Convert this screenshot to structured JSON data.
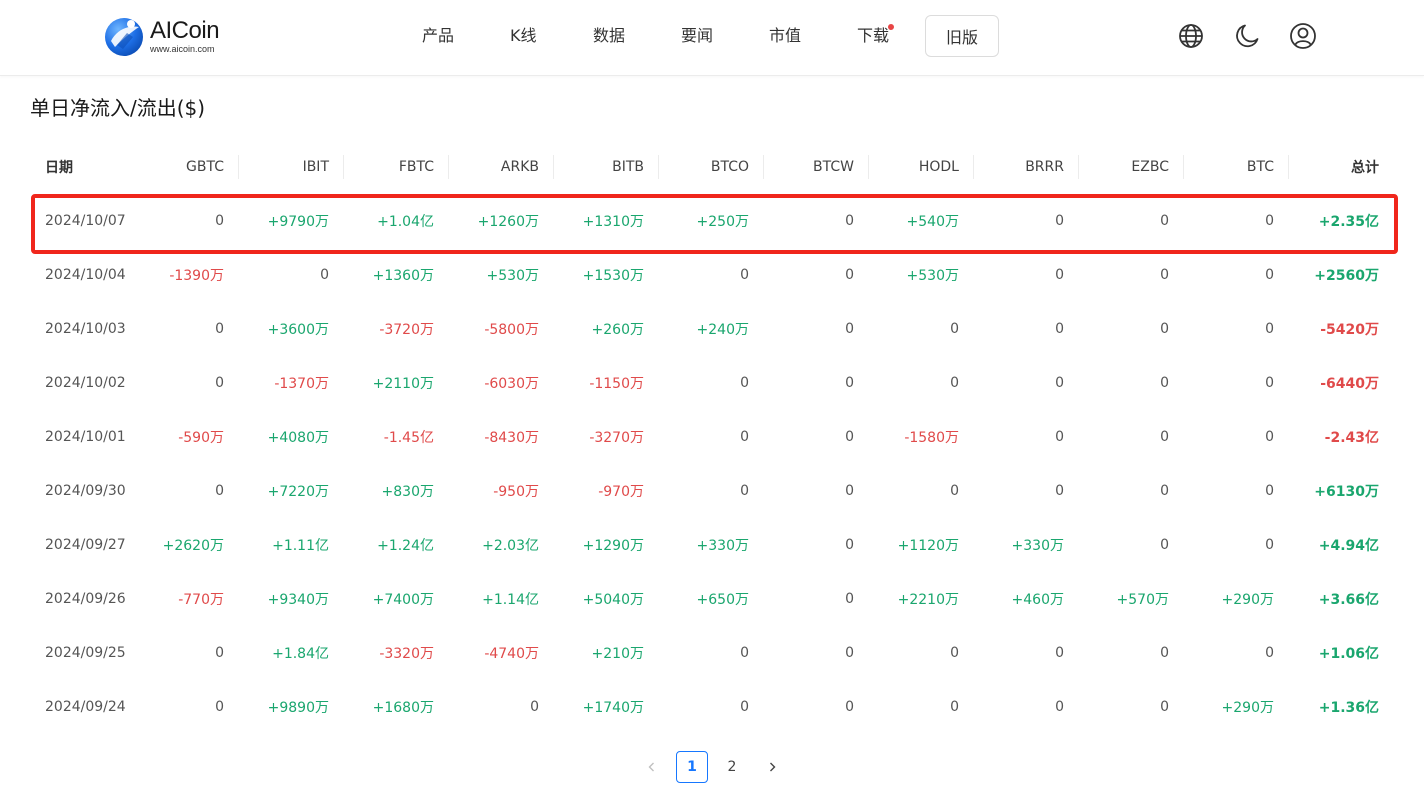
{
  "brand": {
    "name": "AICoin",
    "url": "www.aicoin.com"
  },
  "nav": {
    "items": [
      {
        "label": "产品"
      },
      {
        "label": "K线"
      },
      {
        "label": "数据"
      },
      {
        "label": "要闻"
      },
      {
        "label": "市值"
      },
      {
        "label": "下载",
        "has_dot": true
      }
    ],
    "old_version_label": "旧版"
  },
  "header_icons": [
    "globe-icon",
    "moon-icon",
    "user-icon"
  ],
  "section_title": "单日净流入/流出($)",
  "table": {
    "columns": [
      "日期",
      "GBTC",
      "IBIT",
      "FBTC",
      "ARKB",
      "BITB",
      "BTCO",
      "BTCW",
      "HODL",
      "BRRR",
      "EZBC",
      "BTC",
      "总计"
    ],
    "rows": [
      [
        "2024/10/07",
        "0",
        "+9790万",
        "+1.04亿",
        "+1260万",
        "+1310万",
        "+250万",
        "0",
        "+540万",
        "0",
        "0",
        "0",
        "+2.35亿"
      ],
      [
        "2024/10/04",
        "-1390万",
        "0",
        "+1360万",
        "+530万",
        "+1530万",
        "0",
        "0",
        "+530万",
        "0",
        "0",
        "0",
        "+2560万"
      ],
      [
        "2024/10/03",
        "0",
        "+3600万",
        "-3720万",
        "-5800万",
        "+260万",
        "+240万",
        "0",
        "0",
        "0",
        "0",
        "0",
        "-5420万"
      ],
      [
        "2024/10/02",
        "0",
        "-1370万",
        "+2110万",
        "-6030万",
        "-1150万",
        "0",
        "0",
        "0",
        "0",
        "0",
        "0",
        "-6440万"
      ],
      [
        "2024/10/01",
        "-590万",
        "+4080万",
        "-1.45亿",
        "-8430万",
        "-3270万",
        "0",
        "0",
        "-1580万",
        "0",
        "0",
        "0",
        "-2.43亿"
      ],
      [
        "2024/09/30",
        "0",
        "+7220万",
        "+830万",
        "-950万",
        "-970万",
        "0",
        "0",
        "0",
        "0",
        "0",
        "0",
        "+6130万"
      ],
      [
        "2024/09/27",
        "+2620万",
        "+1.11亿",
        "+1.24亿",
        "+2.03亿",
        "+1290万",
        "+330万",
        "0",
        "+1120万",
        "+330万",
        "0",
        "0",
        "+4.94亿"
      ],
      [
        "2024/09/26",
        "-770万",
        "+9340万",
        "+7400万",
        "+1.14亿",
        "+5040万",
        "+650万",
        "0",
        "+2210万",
        "+460万",
        "+570万",
        "+290万",
        "+3.66亿"
      ],
      [
        "2024/09/25",
        "0",
        "+1.84亿",
        "-3320万",
        "-4740万",
        "+210万",
        "0",
        "0",
        "0",
        "0",
        "0",
        "0",
        "+1.06亿"
      ],
      [
        "2024/09/24",
        "0",
        "+9890万",
        "+1680万",
        "0",
        "+1740万",
        "0",
        "0",
        "0",
        "0",
        "0",
        "+290万",
        "+1.36亿"
      ]
    ],
    "highlighted_row": 0
  },
  "pagination": {
    "prev_icon": "chevron-left-icon",
    "next_icon": "chevron-right-icon",
    "pages": [
      "1",
      "2"
    ],
    "current": "1"
  },
  "colors": {
    "positive": "#1aa66e",
    "negative": "#e04a4a",
    "highlight": "#f0261c",
    "accent": "#1677ff"
  }
}
